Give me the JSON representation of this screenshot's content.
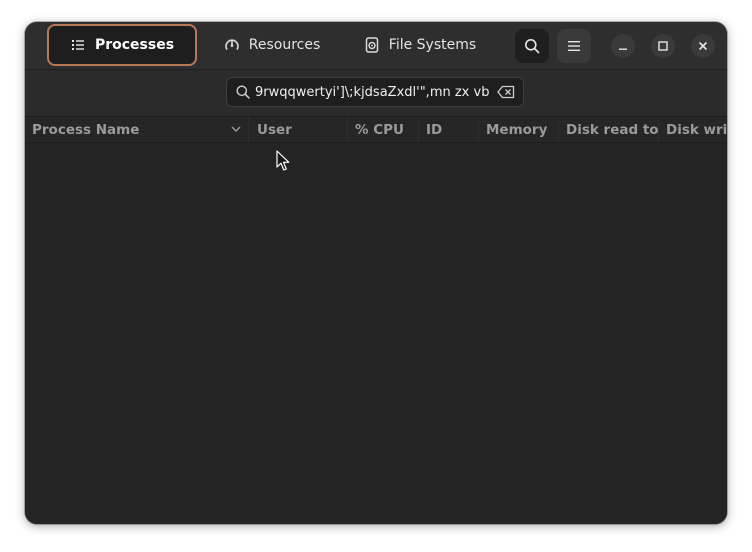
{
  "window": {
    "tabs": [
      {
        "label": "Processes",
        "icon": "list-icon",
        "active": true
      },
      {
        "label": "Resources",
        "icon": "gauge-icon",
        "active": false
      },
      {
        "label": "File Systems",
        "icon": "disk-icon",
        "active": false
      }
    ],
    "header_buttons": [
      "search-icon",
      "hamburger-menu-icon"
    ],
    "window_controls": [
      "minimize-icon",
      "maximize-icon",
      "close-icon"
    ]
  },
  "search": {
    "value": "9rwqqwertyi']\\;kjdsaZxdl'\",mn zx vb",
    "icon": "search-icon",
    "clear_icon": "backspace-clear-icon"
  },
  "table": {
    "columns": [
      "Process Name",
      "User",
      "% CPU",
      "ID",
      "Memory",
      "Disk read total",
      "Disk write total"
    ],
    "sorted_column": "Process Name",
    "rows": []
  },
  "colors": {
    "accent": "#b5795a",
    "background": "#242424",
    "header": "#2e2e2e"
  }
}
